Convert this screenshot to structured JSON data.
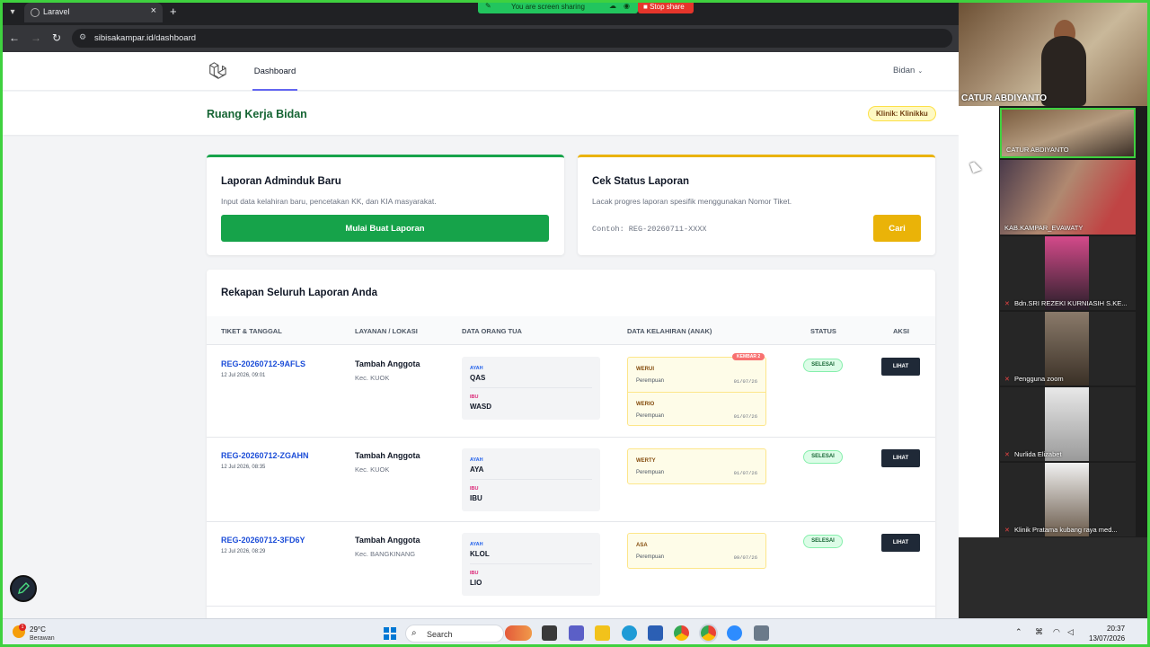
{
  "browser": {
    "tab_title": "Laravel",
    "url": "sibisakampar.id/dashboard",
    "sharing_text": "You are screen sharing",
    "stop_share": "Stop share"
  },
  "nav": {
    "dashboard": "Dashboard",
    "user": "Bidan",
    "user_chevron": "⌄"
  },
  "header": {
    "title": "Ruang Kerja Bidan",
    "clinic": "Klinik: Klinikku"
  },
  "card_new": {
    "title": "Laporan Adminduk Baru",
    "desc": "Input data kelahiran baru, pencetakan KK, dan KIA masyarakat.",
    "button": "Mulai Buat Laporan"
  },
  "card_status": {
    "title": "Cek Status Laporan",
    "desc": "Lacak progres laporan spesifik menggunakan Nomor Tiket.",
    "placeholder": "Contoh: REG-20260711-XXXX",
    "button": "Cari"
  },
  "table": {
    "title": "Rekapan Seluruh Laporan Anda",
    "headers": {
      "ticket": "TIKET & TANGGAL",
      "service": "LAYANAN / LOKASI",
      "parents": "DATA ORANG TUA",
      "birth": "DATA KELAHIRAN (ANAK)",
      "status": "STATUS",
      "action": "AKSI"
    },
    "labels": {
      "ayah": "AYAH",
      "ibu": "IBU",
      "twin": "KEMBAR 2",
      "lihat": "LIHAT"
    },
    "rows": [
      {
        "ticket": "REG-20260712-9AFLS",
        "date": "12 Jul 2026, 09:01",
        "service": "Tambah Anggota",
        "location": "Kec. KUOK",
        "father": "QAS",
        "mother": "WASD",
        "children": [
          {
            "name": "WERUI",
            "gender": "Perempuan",
            "dob": "01/07/26"
          },
          {
            "name": "WERIO",
            "gender": "Perempuan",
            "dob": "01/07/26"
          }
        ],
        "status": "SELESAI"
      },
      {
        "ticket": "REG-20260712-ZGAHN",
        "date": "12 Jul 2026, 08:35",
        "service": "Tambah Anggota",
        "location": "Kec. KUOK",
        "father": "AYA",
        "mother": "IBU",
        "children": [
          {
            "name": "WERTY",
            "gender": "Perempuan",
            "dob": "01/07/26"
          }
        ],
        "status": "SELESAI"
      },
      {
        "ticket": "REG-20260712-3FD6Y",
        "date": "12 Jul 2026, 08:29",
        "service": "Tambah Anggota",
        "location": "Kec. BANGKINANG",
        "father": "KLOL",
        "mother": "LIO",
        "children": [
          {
            "name": "ASA",
            "gender": "Perempuan",
            "dob": "09/07/26"
          }
        ],
        "status": "SELESAI"
      }
    ]
  },
  "zoom": {
    "main_speaker": "CATUR ABDIYANTO",
    "participants": [
      "CATUR ABDIYANTO",
      "KAB.KAMPAR_EVAWATY",
      "Bdn.SRI REZEKI KURNIASIH S.KE...",
      "Pengguna zoom",
      "Nurlida Elizabet",
      "Klinik Pratama kubang raya med..."
    ]
  },
  "taskbar": {
    "temperature": "29°C",
    "condition": "Berawan",
    "weather_alert": "1",
    "search": "Search",
    "time": "20:37",
    "date": "13/07/2026"
  }
}
